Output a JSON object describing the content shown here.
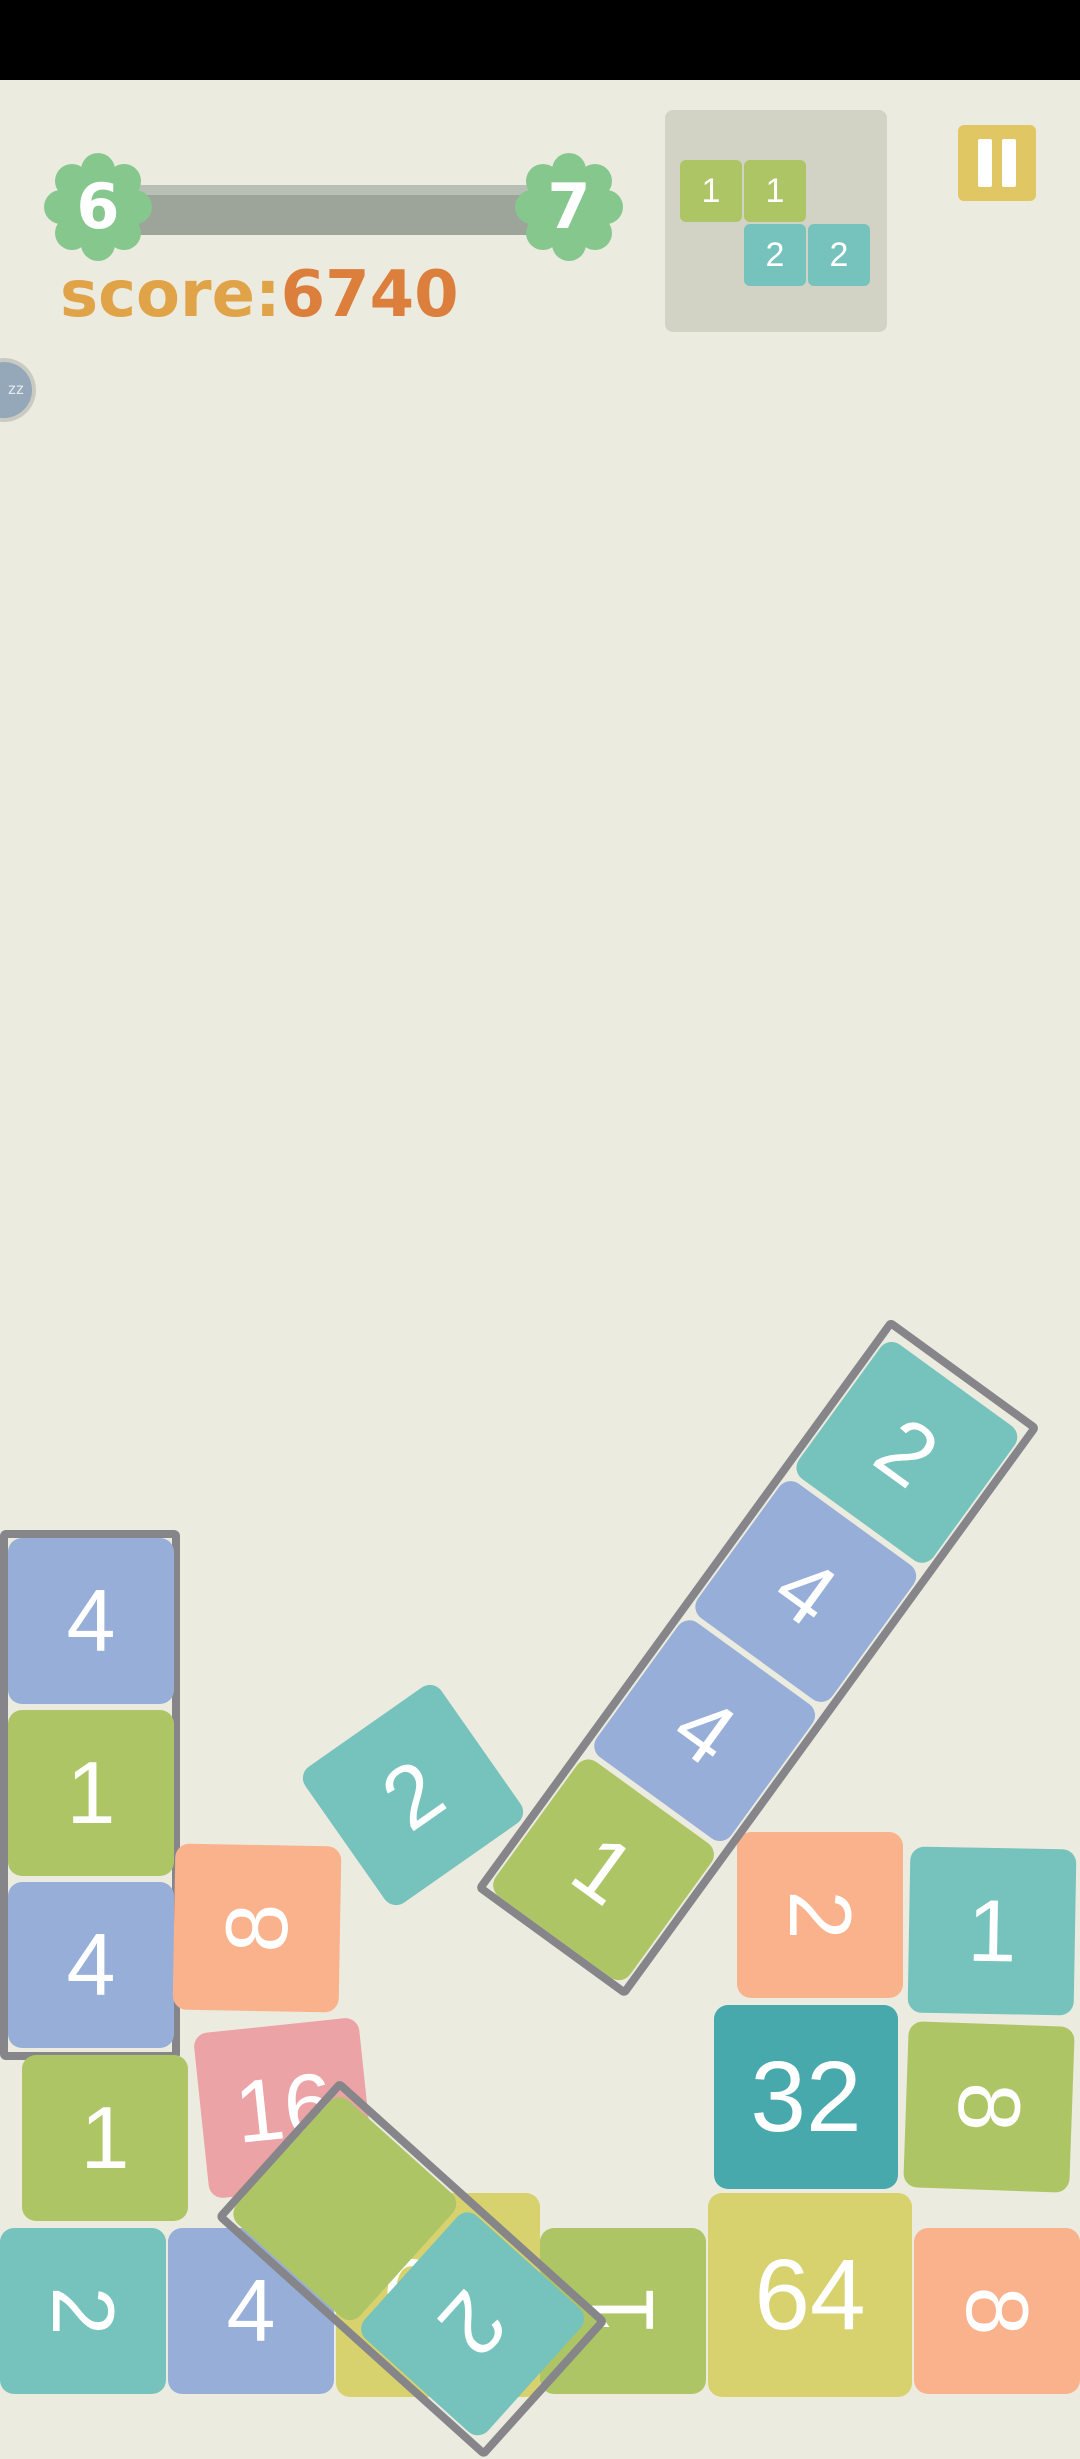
{
  "hud": {
    "current_level": "6",
    "next_level": "7",
    "score_label": "score:",
    "score_value": "6740",
    "side_button_label": "zz"
  },
  "next_piece": [
    "1",
    "1",
    "2",
    "2"
  ],
  "board": {
    "left_column": [
      "4",
      "1",
      "4"
    ],
    "tiles": [
      "1",
      "2",
      "4",
      "64",
      "1",
      "64",
      "8",
      "8",
      "16",
      "32",
      "2",
      "1",
      "8",
      "2"
    ],
    "tilted_bar": [
      "2",
      "4",
      "4",
      "1"
    ],
    "tilted_pair": [
      "",
      "2"
    ],
    "falling_tile": "2"
  },
  "colors": {
    "background": "#ECEBDF",
    "badge": "#86C78E",
    "score_label": "#E0A347",
    "score_value": "#DC7E3C",
    "pause": "#E1C763",
    "green": "#ADC565",
    "blue": "#96AED8",
    "teal": "#76C2BC",
    "orange": "#F9B28B",
    "pink": "#EBA3A5",
    "yellow": "#D8D26E",
    "dark_teal": "#48A9AD"
  }
}
